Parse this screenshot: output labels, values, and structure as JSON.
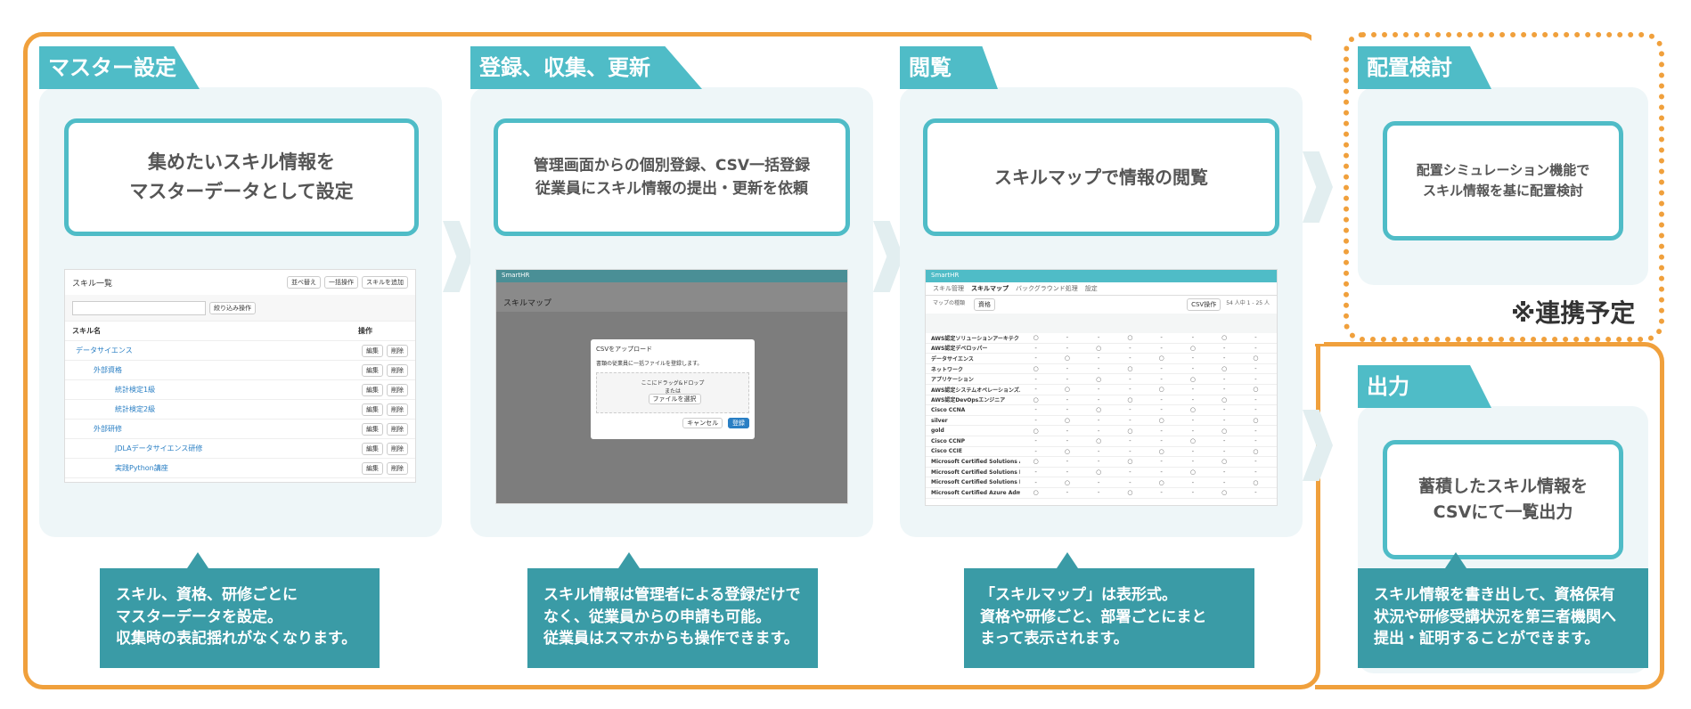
{
  "sections": [
    {
      "tab": "マスター設定",
      "box": [
        "集めたいスキル情報を",
        "マスターデータとして設定"
      ],
      "note": [
        "スキル、資格、研修ごとに",
        "マスターデータを設定。",
        "収集時の表記揺れがなくなります。"
      ]
    },
    {
      "tab": "登録、収集、更新",
      "box": [
        "管理画面からの個別登録、CSV一括登録",
        "従業員にスキル情報の提出・更新を依頼"
      ],
      "note": [
        "スキル情報は管理者による登録だけで",
        "なく、従業員からの申請も可能。",
        "従業員はスマホからも操作できます。"
      ]
    },
    {
      "tab": "閲覧",
      "box": [
        "スキルマップで情報の閲覧"
      ],
      "note": [
        "「スキルマップ」は表形式。",
        "資格や研修ごと、部署ごとにまと",
        "まって表示されます。"
      ]
    },
    {
      "tab": "配置検討",
      "box": [
        "配置シミュレーション機能で",
        "スキル情報を基に配置検討"
      ]
    },
    {
      "tab": "出力",
      "box": [
        "蓄積したスキル情報を",
        "CSVにて一覧出力"
      ],
      "note": [
        "スキル情報を書き出して、資格保有",
        "状況や研修受講状況を第三者機関へ",
        "提出・証明することができます。"
      ]
    }
  ],
  "future_label": "※連携予定",
  "shot1": {
    "title": "スキル一覧",
    "buttons": [
      "並べ替え",
      "一括操作",
      "スキルを追加"
    ],
    "filter_button": "絞り込み操作",
    "col_name": "スキル名",
    "col_ops": "操作",
    "rows": [
      "データサイエンス",
      "外部資格",
      "統計検定1級",
      "統計検定2級",
      "外部研修",
      "JDLAデータサイエンス研修",
      "実践Python講座"
    ],
    "edit": "編集",
    "del": "削除"
  },
  "shot2": {
    "brand": "SmartHR",
    "title": "スキルマップ",
    "dialog_title": "CSVをアップロード",
    "dialog_text": "書類の従業員に一括ファイルを登録します。",
    "drop_text": "ここにドラッグ&ドロップ",
    "or_text": "または",
    "file_button": "ファイルを選択",
    "cancel": "キャンセル",
    "ok": "登録"
  },
  "shot3": {
    "brand": "SmartHR",
    "tabs": [
      "スキル管理",
      "スキルマップ",
      "バックグラウンド処理",
      "設定"
    ],
    "filter_label": "マップの種類",
    "filter_value": "資格",
    "csv_button": "CSV操作",
    "count": "54 人中 1 - 25 人",
    "rows": [
      "AWS認定ソリューションアーキテクト",
      "AWS認定デベロッパー",
      "データサイエンス",
      "ネットワーク",
      "アプリケーション",
      "AWS認定システムオペレーションズ…",
      "AWS認定DevOpsエンジニア",
      "Cisco CCNA",
      "silver",
      "gold",
      "Cisco CCNP",
      "Cisco CCIE",
      "Microsoft Certified Solutions Asso…",
      "Microsoft Certified Solutions Exper…",
      "Microsoft Certified Solutions Devel…",
      "Microsoft Certified Azure Administr…"
    ]
  },
  "colors": {
    "accent": "#4fbcc7",
    "note": "#3a9ba6",
    "frame": "#f0a03c",
    "panel": "#eef6f8"
  }
}
